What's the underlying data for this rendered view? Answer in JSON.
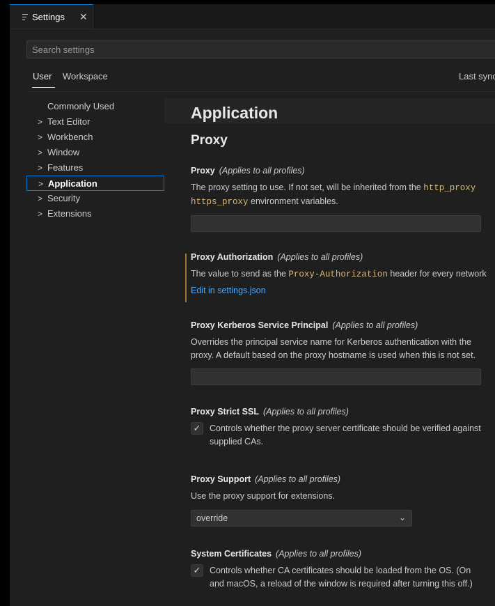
{
  "tab": {
    "label": "Settings",
    "close": "✕"
  },
  "search": {
    "placeholder": "Search settings"
  },
  "scopes": {
    "user": "User",
    "workspace": "Workspace",
    "last_sync": "Last sync"
  },
  "toc": [
    {
      "label": "Commonly Used",
      "chevron": ""
    },
    {
      "label": "Text Editor",
      "chevron": ">"
    },
    {
      "label": "Workbench",
      "chevron": ">"
    },
    {
      "label": "Window",
      "chevron": ">"
    },
    {
      "label": "Features",
      "chevron": ">"
    },
    {
      "label": "Application",
      "chevron": ">",
      "selected": true
    },
    {
      "label": "Security",
      "chevron": ">"
    },
    {
      "label": "Extensions",
      "chevron": ">"
    }
  ],
  "content": {
    "section_title": "Application",
    "sub_title": "Proxy",
    "proxy": {
      "title": "Proxy",
      "scope": "(Applies to all profiles)",
      "desc_pre": "The proxy setting to use. If not set, will be inherited from the ",
      "desc_code1": "http_proxy",
      "desc_code2": "https_proxy",
      "desc_post": " environment variables.",
      "value": ""
    },
    "proxy_auth": {
      "title": "Proxy Authorization",
      "scope": "(Applies to all profiles)",
      "desc_pre": "The value to send as the ",
      "desc_code": "Proxy-Authorization",
      "desc_post": " header for every network",
      "link": "Edit in settings.json"
    },
    "kerberos": {
      "title": "Proxy Kerberos Service Principal",
      "scope": "(Applies to all profiles)",
      "desc_line1": "Overrides the principal service name for Kerberos authentication with the",
      "desc_line2": "proxy. A default based on the proxy hostname is used when this is not set.",
      "value": ""
    },
    "strict_ssl": {
      "title": "Proxy Strict SSL",
      "scope": "(Applies to all profiles)",
      "checked": true,
      "check_glyph": "✓",
      "desc_line1": "Controls whether the proxy server certificate should be verified against",
      "desc_line2": "supplied CAs."
    },
    "proxy_support": {
      "title": "Proxy Support",
      "scope": "(Applies to all profiles)",
      "desc": "Use the proxy support for extensions.",
      "selected": "override",
      "caret": "⌄"
    },
    "system_certs": {
      "title": "System Certificates",
      "scope": "(Applies to all profiles)",
      "checked": true,
      "check_glyph": "✓",
      "desc_line1": "Controls whether CA certificates should be loaded from the OS. (On",
      "desc_line2": "and macOS, a reload of the window is required after turning this off.)"
    }
  },
  "colors": {
    "accent": "#0078d4",
    "modified_bar": "#a3752b",
    "code": "#d7ba7d",
    "link": "#4daafc"
  }
}
